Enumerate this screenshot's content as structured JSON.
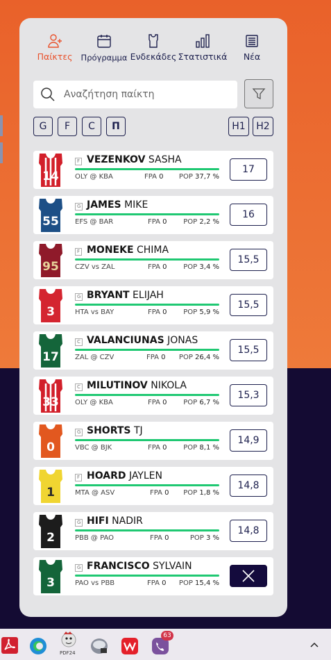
{
  "tabs": [
    {
      "label": "Παίκτες",
      "icon": "add-player-icon",
      "active": true
    },
    {
      "label": "Πρόγραμμα",
      "icon": "calendar-icon",
      "active": false
    },
    {
      "label": "Ενδεκάδες",
      "icon": "jersey-icon",
      "active": false
    },
    {
      "label": "Στατιστικά",
      "icon": "bar-chart-icon",
      "active": false
    },
    {
      "label": "Νέα",
      "icon": "news-icon",
      "active": false
    }
  ],
  "search": {
    "placeholder": "Αναζήτηση παίκτη"
  },
  "position_filters": [
    "G",
    "F",
    "C",
    "Π"
  ],
  "half_filters": [
    "H1",
    "H2"
  ],
  "players": [
    {
      "pos": "F",
      "last": "VEZENKOV",
      "first": "SASHA",
      "game": "OLY @ KBA",
      "fpa_label": "FPA",
      "fpa": "0",
      "pop_label": "POP",
      "pop": "37,7 %",
      "price": "17",
      "jersey_num": "14",
      "jersey_color": "#d21f2a",
      "jersey_style": "stripes",
      "selected": false
    },
    {
      "pos": "G",
      "last": "JAMES",
      "first": "MIKE",
      "game": "EFS @ BAR",
      "fpa_label": "FPA",
      "fpa": "0",
      "pop_label": "POP",
      "pop": "2,2 %",
      "price": "16",
      "jersey_num": "55",
      "jersey_color": "#1d4f86",
      "jersey_style": "solid",
      "selected": false
    },
    {
      "pos": "F",
      "last": "MONEKE",
      "first": "CHIMA",
      "game": "CZV vs ZAL",
      "fpa_label": "FPA",
      "fpa": "0",
      "pop_label": "POP",
      "pop": "3,4 %",
      "price": "15,5",
      "jersey_num": "95",
      "jersey_color": "#8f1a2a",
      "jersey_style": "solid",
      "selected": false
    },
    {
      "pos": "G",
      "last": "BRYANT",
      "first": "ELIJAH",
      "game": "HTA vs BAY",
      "fpa_label": "FPA",
      "fpa": "0",
      "pop_label": "POP",
      "pop": "5,9 %",
      "price": "15,5",
      "jersey_num": "3",
      "jersey_color": "#d42530",
      "jersey_style": "solid",
      "selected": false
    },
    {
      "pos": "C",
      "last": "VALANCIUNAS",
      "first": "JONAS",
      "game": "ZAL @ CZV",
      "fpa_label": "FPA",
      "fpa": "0",
      "pop_label": "POP",
      "pop": "26,4 %",
      "price": "15,5",
      "jersey_num": "17",
      "jersey_color": "#14653a",
      "jersey_style": "solid",
      "selected": false
    },
    {
      "pos": "C",
      "last": "MILUTINOV",
      "first": "NIKOLA",
      "game": "OLY @ KBA",
      "fpa_label": "FPA",
      "fpa": "0",
      "pop_label": "POP",
      "pop": "6,7 %",
      "price": "15,3",
      "jersey_num": "33",
      "jersey_color": "#d21f2a",
      "jersey_style": "stripes",
      "selected": false
    },
    {
      "pos": "G",
      "last": "SHORTS",
      "first": "TJ",
      "game": "VBC @ BJK",
      "fpa_label": "FPA",
      "fpa": "0",
      "pop_label": "POP",
      "pop": "8,1 %",
      "price": "14,9",
      "jersey_num": "0",
      "jersey_color": "#e2581f",
      "jersey_style": "solid",
      "selected": false
    },
    {
      "pos": "F",
      "last": "HOARD",
      "first": "JAYLEN",
      "game": "MTA @ ASV",
      "fpa_label": "FPA",
      "fpa": "0",
      "pop_label": "POP",
      "pop": "1,8 %",
      "price": "14,8",
      "jersey_num": "1",
      "jersey_color": "#f0d531",
      "jersey_style": "solid",
      "selected": false
    },
    {
      "pos": "G",
      "last": "HIFI",
      "first": "NADIR",
      "game": "PBB @ PAO",
      "fpa_label": "FPA",
      "fpa": "0",
      "pop_label": "POP",
      "pop": "3 %",
      "price": "14,8",
      "jersey_num": "2",
      "jersey_color": "#1c1c1c",
      "jersey_style": "solid",
      "selected": false
    },
    {
      "pos": "G",
      "last": "FRANCISCO",
      "first": "SYLVAIN",
      "game": "PAO vs PBB",
      "fpa_label": "FPA",
      "fpa": "0",
      "pop_label": "POP",
      "pop": "15,4 %",
      "price": "",
      "jersey_num": "3",
      "jersey_color": "#14653a",
      "jersey_style": "solid",
      "selected": true
    }
  ],
  "taskbar": {
    "icons": [
      "pdf-reader-icon",
      "edge-browser-icon",
      "pdf24-icon",
      "disk-tool-icon",
      "wps-office-icon",
      "viber-icon"
    ],
    "pdf24_caption": "PDF24",
    "viber_badge": "63"
  },
  "colors": {
    "accent": "#e9502a",
    "navy": "#1c1f4d",
    "green_bar": "#1fc872"
  }
}
